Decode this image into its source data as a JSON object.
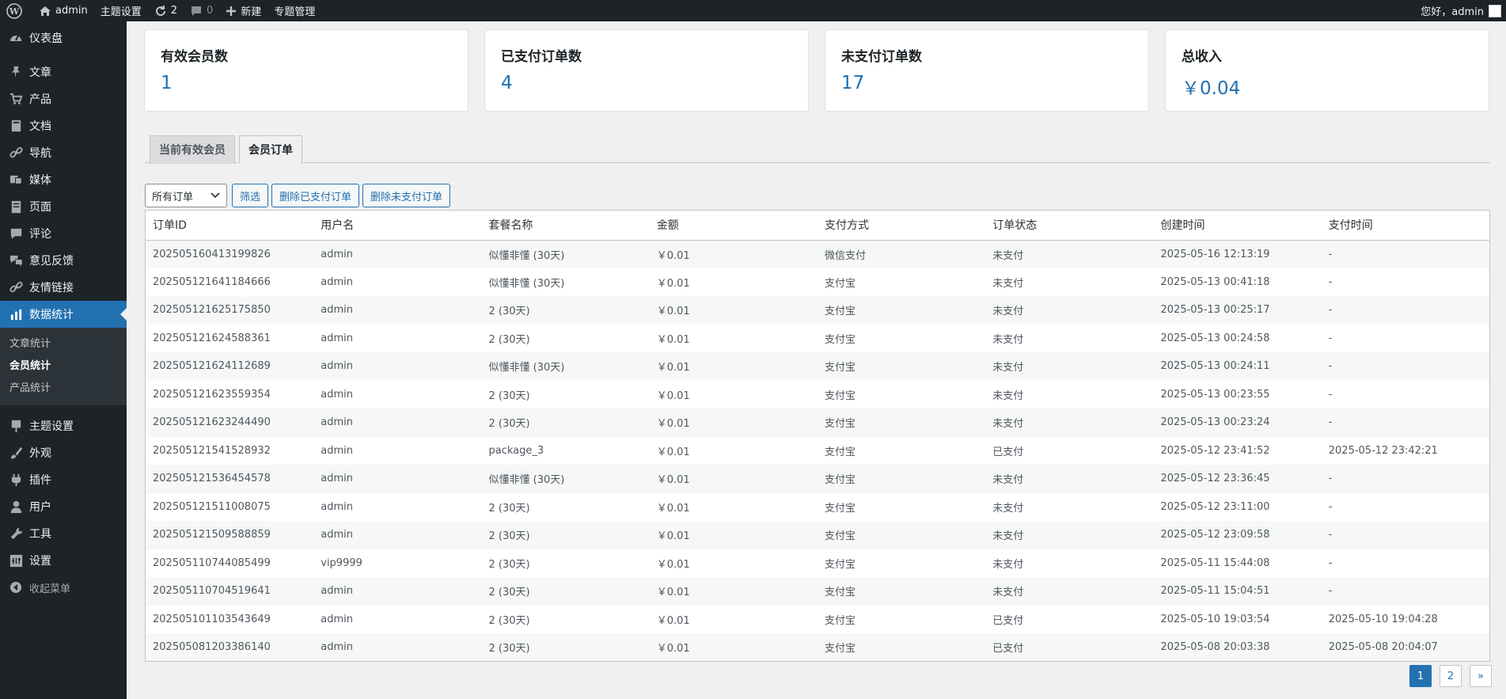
{
  "adminbar": {
    "site": "admin",
    "theme_settings": "主题设置",
    "updates_count": "2",
    "comments_count": "0",
    "new_label": "新建",
    "topics": "专题管理",
    "greeting": "您好，admin"
  },
  "sidebar": {
    "top": [
      {
        "label": "仪表盘",
        "icon": "dashboard-icon"
      }
    ],
    "items": [
      {
        "label": "文章",
        "icon": "pin-icon"
      },
      {
        "label": "产品",
        "icon": "cart-icon"
      },
      {
        "label": "文档",
        "icon": "book-icon"
      },
      {
        "label": "导航",
        "icon": "link-icon"
      },
      {
        "label": "媒体",
        "icon": "media-icon"
      },
      {
        "label": "页面",
        "icon": "page-icon"
      },
      {
        "label": "评论",
        "icon": "comment-icon"
      },
      {
        "label": "意见反馈",
        "icon": "feedback-icon"
      },
      {
        "label": "友情链接",
        "icon": "link-icon"
      },
      {
        "label": "数据统计",
        "icon": "chart-icon"
      }
    ],
    "submenu": [
      "文章统计",
      "会员统计",
      "产品统计"
    ],
    "bottom": [
      {
        "label": "主题设置",
        "icon": "theme-icon"
      },
      {
        "label": "外观",
        "icon": "brush-icon"
      },
      {
        "label": "插件",
        "icon": "plugin-icon"
      },
      {
        "label": "用户",
        "icon": "user-icon"
      },
      {
        "label": "工具",
        "icon": "wrench-icon"
      },
      {
        "label": "设置",
        "icon": "settings-icon"
      }
    ],
    "collapse": "收起菜单"
  },
  "stats": [
    {
      "label": "有效会员数",
      "value": "1"
    },
    {
      "label": "已支付订单数",
      "value": "4"
    },
    {
      "label": "未支付订单数",
      "value": "17"
    },
    {
      "label": "总收入",
      "value": "￥0.04"
    }
  ],
  "tabs": [
    "当前有效会员",
    "会员订单"
  ],
  "filter": {
    "select_value": "所有订单",
    "filter_btn": "筛选",
    "delete_paid": "删除已支付订单",
    "delete_unpaid": "删除未支付订单"
  },
  "table": {
    "headers": [
      "订单ID",
      "用户名",
      "套餐名称",
      "金额",
      "支付方式",
      "订单状态",
      "创建时间",
      "支付时间"
    ],
    "rows": [
      [
        "202505160413199826",
        "admin",
        "似懂非懂 (30天)",
        "￥0.01",
        "微信支付",
        "未支付",
        "2025-05-16 12:13:19",
        "-"
      ],
      [
        "202505121641184666",
        "admin",
        "似懂非懂 (30天)",
        "￥0.01",
        "支付宝",
        "未支付",
        "2025-05-13 00:41:18",
        "-"
      ],
      [
        "202505121625175850",
        "admin",
        "2 (30天)",
        "￥0.01",
        "支付宝",
        "未支付",
        "2025-05-13 00:25:17",
        "-"
      ],
      [
        "202505121624588361",
        "admin",
        "2 (30天)",
        "￥0.01",
        "支付宝",
        "未支付",
        "2025-05-13 00:24:58",
        "-"
      ],
      [
        "202505121624112689",
        "admin",
        "似懂非懂 (30天)",
        "￥0.01",
        "支付宝",
        "未支付",
        "2025-05-13 00:24:11",
        "-"
      ],
      [
        "202505121623559354",
        "admin",
        "2 (30天)",
        "￥0.01",
        "支付宝",
        "未支付",
        "2025-05-13 00:23:55",
        "-"
      ],
      [
        "202505121623244490",
        "admin",
        "2 (30天)",
        "￥0.01",
        "支付宝",
        "未支付",
        "2025-05-13 00:23:24",
        "-"
      ],
      [
        "202505121541528932",
        "admin",
        "package_3",
        "￥0.01",
        "支付宝",
        "已支付",
        "2025-05-12 23:41:52",
        "2025-05-12 23:42:21"
      ],
      [
        "202505121536454578",
        "admin",
        "似懂非懂 (30天)",
        "￥0.01",
        "支付宝",
        "未支付",
        "2025-05-12 23:36:45",
        "-"
      ],
      [
        "202505121511008075",
        "admin",
        "2 (30天)",
        "￥0.01",
        "支付宝",
        "未支付",
        "2025-05-12 23:11:00",
        "-"
      ],
      [
        "202505121509588859",
        "admin",
        "2 (30天)",
        "￥0.01",
        "支付宝",
        "未支付",
        "2025-05-12 23:09:58",
        "-"
      ],
      [
        "202505110744085499",
        "vip9999",
        "2 (30天)",
        "￥0.01",
        "支付宝",
        "未支付",
        "2025-05-11 15:44:08",
        "-"
      ],
      [
        "202505110704519641",
        "admin",
        "2 (30天)",
        "￥0.01",
        "支付宝",
        "未支付",
        "2025-05-11 15:04:51",
        "-"
      ],
      [
        "202505101103543649",
        "admin",
        "2 (30天)",
        "￥0.01",
        "支付宝",
        "已支付",
        "2025-05-10 19:03:54",
        "2025-05-10 19:04:28"
      ],
      [
        "202505081203386140",
        "admin",
        "2 (30天)",
        "￥0.01",
        "支付宝",
        "已支付",
        "2025-05-08 20:03:38",
        "2025-05-08 20:04:07"
      ]
    ]
  },
  "pagination": [
    "1",
    "2",
    "»"
  ]
}
